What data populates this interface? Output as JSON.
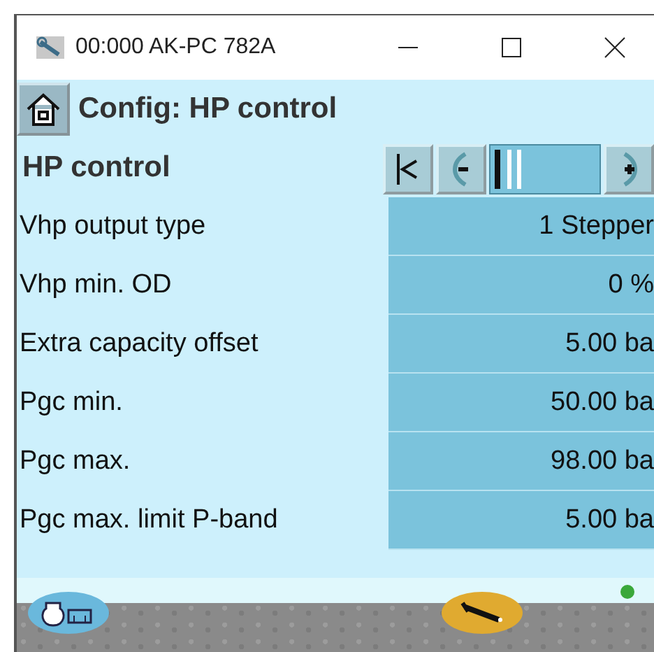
{
  "window": {
    "title": "00:000 AK-PC 782A"
  },
  "header": {
    "title": "Config: HP control"
  },
  "section": {
    "title": "HP control"
  },
  "parameters": [
    {
      "label": "Vhp output type",
      "value": "1 Stepper"
    },
    {
      "label": "Vhp min. OD",
      "value": "0 %"
    },
    {
      "label": "Extra capacity offset",
      "value": "5.00 ba"
    },
    {
      "label": "Pgc min.",
      "value": "50.00 ba"
    },
    {
      "label": "Pgc max.",
      "value": "98.00 ba"
    },
    {
      "label": "Pgc max. limit P-band",
      "value": "5.00 ba"
    }
  ],
  "status": {
    "color": "#3aa83a"
  }
}
